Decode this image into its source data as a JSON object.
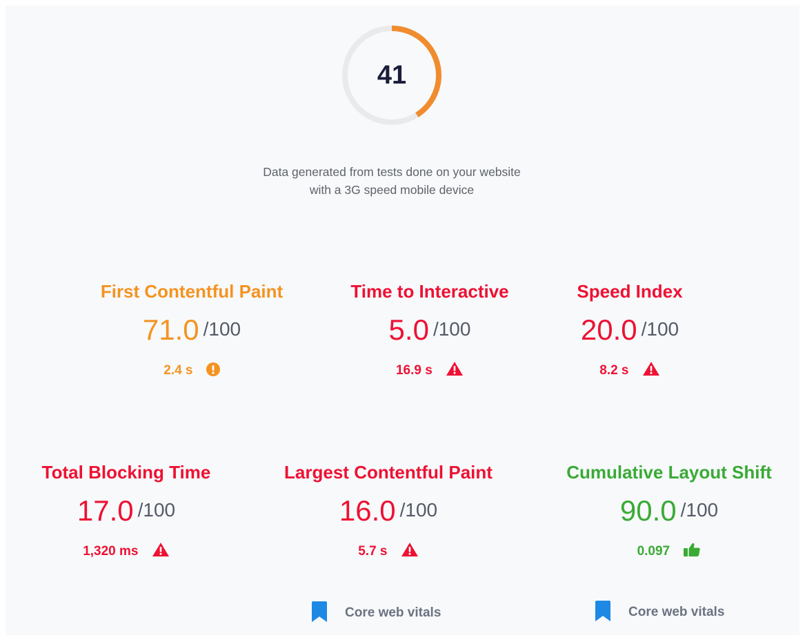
{
  "gauge": {
    "score": "41",
    "score_fraction": 0.41,
    "arc_color": "#f08c2e",
    "track_color": "#e9eaec"
  },
  "description": "Data generated from tests done on your website with a 3G speed mobile device",
  "metrics": [
    {
      "title": "First Contentful Paint",
      "score": "71.0",
      "max": "/100",
      "detail": "2.4 s",
      "status": "warning",
      "icon": "info-circle-icon",
      "color": "#f59321"
    },
    {
      "title": "Time to Interactive",
      "score": "5.0",
      "max": "/100",
      "detail": "16.9 s",
      "status": "fail",
      "icon": "warning-triangle-icon",
      "color": "#ee1133"
    },
    {
      "title": "Speed Index",
      "score": "20.0",
      "max": "/100",
      "detail": "8.2 s",
      "status": "fail",
      "icon": "warning-triangle-icon",
      "color": "#ee1133"
    },
    {
      "title": "Total Blocking Time",
      "score": "17.0",
      "max": "/100",
      "detail": "1,320 ms",
      "status": "fail",
      "icon": "warning-triangle-icon",
      "color": "#ee1133"
    },
    {
      "title": "Largest Contentful Paint",
      "score": "16.0",
      "max": "/100",
      "detail": "5.7 s",
      "status": "fail",
      "icon": "warning-triangle-icon",
      "color": "#ee1133"
    },
    {
      "title": "Cumulative Layout Shift",
      "score": "90.0",
      "max": "/100",
      "detail": "0.097",
      "status": "pass",
      "icon": "thumbs-up-icon",
      "color": "#3aaa35"
    }
  ],
  "core_web_vitals": {
    "label_1": "Core web vitals",
    "label_2": "Core web vitals",
    "icon": "bookmark-icon",
    "icon_color": "#1e88e5"
  }
}
